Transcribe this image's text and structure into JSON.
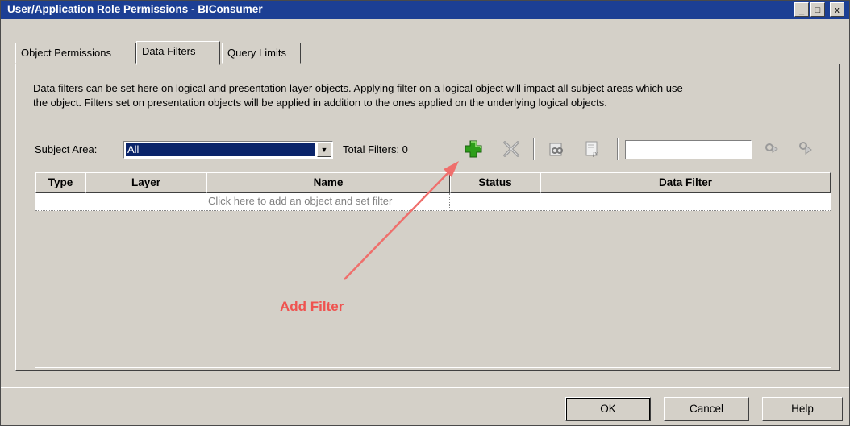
{
  "window": {
    "title": "User/Application Role Permissions - BIConsumer",
    "controls": {
      "minimize": "_",
      "maximize": "□",
      "close": "x"
    }
  },
  "tabs": [
    {
      "label": "Object Permissions",
      "active": false
    },
    {
      "label": "Data Filters",
      "active": true
    },
    {
      "label": "Query Limits",
      "active": false
    }
  ],
  "description": {
    "line1": "Data filters can be set here on logical and presentation layer objects. Applying filter on a logical object will impact all subject areas which use",
    "line2": "the object. Filters set on presentation objects will be applied in addition to the ones applied on the underlying logical objects."
  },
  "subject_area": {
    "label": "Subject Area:",
    "value": "All"
  },
  "total_filters": "Total Filters: 0",
  "toolbar": {
    "icons": [
      "add-filter-icon",
      "delete-filter-icon",
      "find-icon",
      "expression-icon",
      "find-next-icon",
      "find-previous-icon"
    ],
    "search_value": ""
  },
  "table": {
    "columns": [
      "Type",
      "Layer",
      "Name",
      "Status",
      "Data Filter"
    ],
    "placeholder_row": "Click here to add an object and set filter"
  },
  "annotation": {
    "text": "Add Filter",
    "color": "#ef5350"
  },
  "buttons": {
    "ok": "OK",
    "cancel": "Cancel",
    "help": "Help"
  },
  "colors": {
    "title_bar": "#1c3f94",
    "dialog": "#d4d0c8",
    "add_green": "#2e9e1a"
  }
}
